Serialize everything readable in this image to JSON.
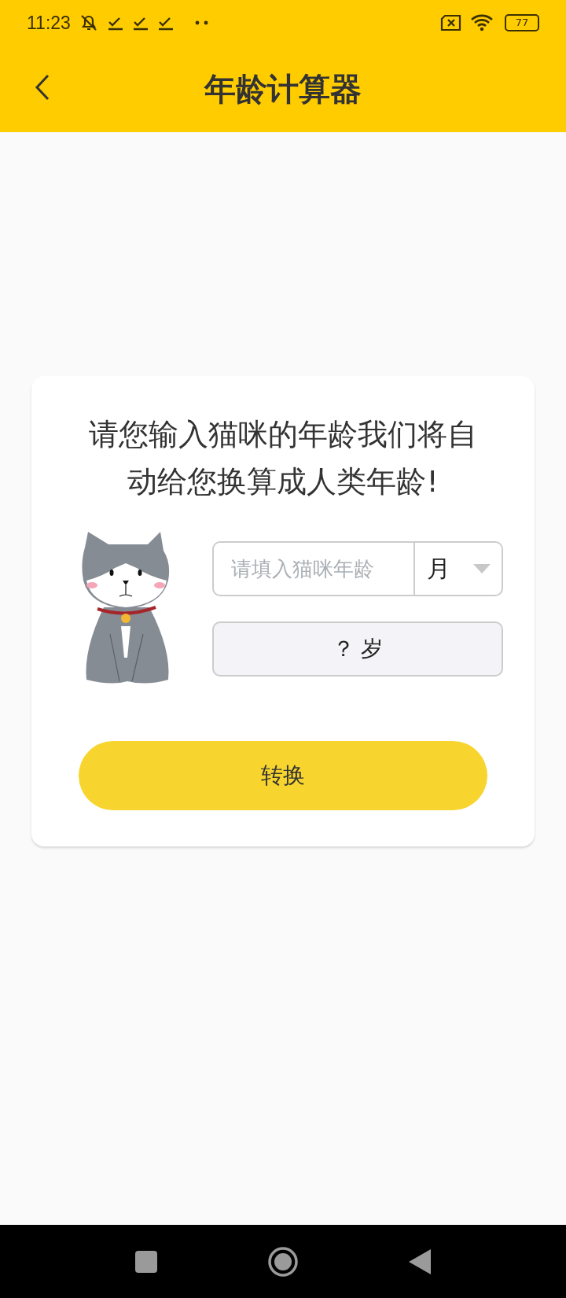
{
  "status_bar": {
    "time": "11:23",
    "battery": "77"
  },
  "header": {
    "title": "年龄计算器"
  },
  "card": {
    "prompt": "请您输入猫咪的年龄我们将自动给您换算成人类年龄!",
    "age_input": {
      "placeholder": "请填入猫咪年龄"
    },
    "unit": "月",
    "result": "？ 岁",
    "convert_button": "转换"
  }
}
